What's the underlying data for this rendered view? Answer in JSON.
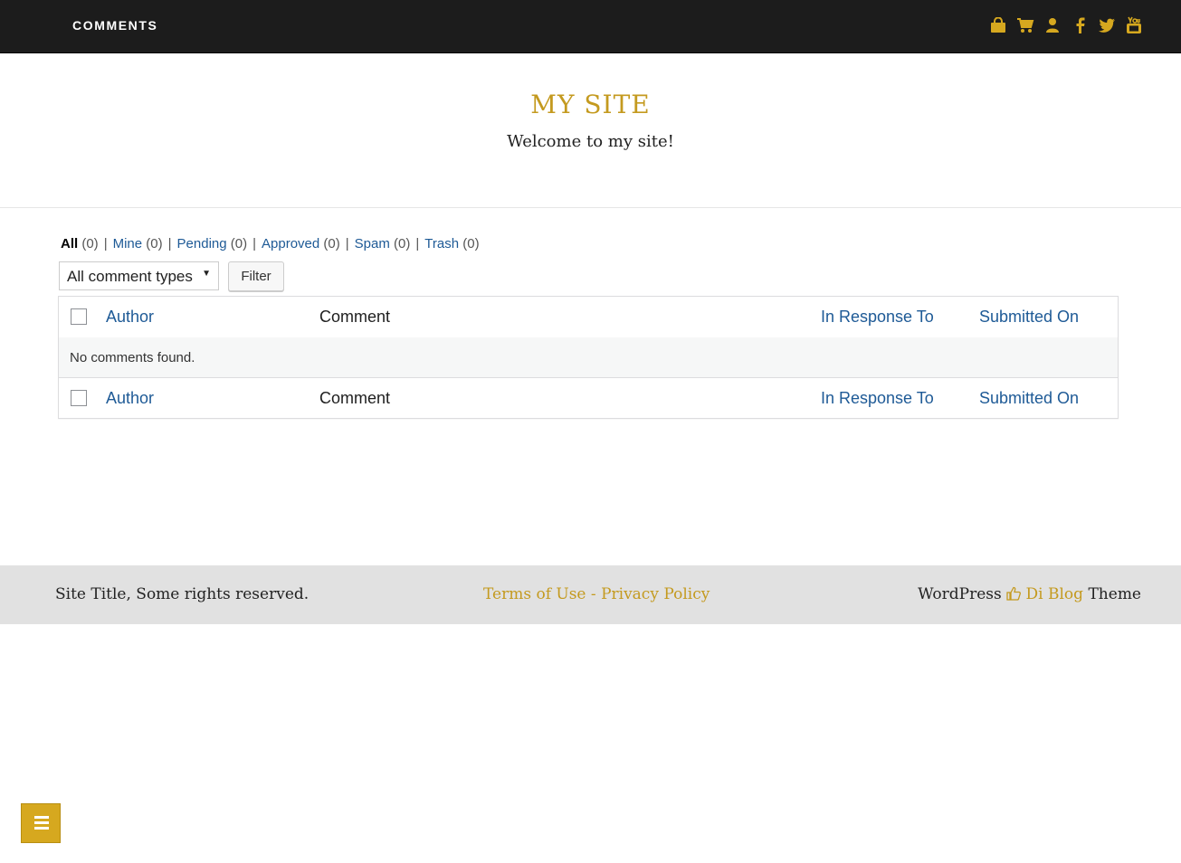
{
  "topbar": {
    "menu_title": "COMMENTS",
    "social_icons": [
      "shopping-bag-icon",
      "shopping-cart-icon",
      "user-icon",
      "facebook-icon",
      "twitter-icon",
      "youtube-icon"
    ],
    "icon_color": "#d6a81f"
  },
  "header": {
    "site_title": "MY SITE",
    "site_description": "Welcome to my site!"
  },
  "filters": {
    "items": [
      {
        "label": "All",
        "count": "(0)"
      },
      {
        "label": "Mine",
        "count": "(0)"
      },
      {
        "label": "Pending",
        "count": "(0)"
      },
      {
        "label": "Approved",
        "count": "(0)"
      },
      {
        "label": "Spam",
        "count": "(0)"
      },
      {
        "label": "Trash",
        "count": "(0)"
      }
    ],
    "separator": "|",
    "type_select": "All comment types",
    "filter_button": "Filter"
  },
  "table": {
    "columns": [
      "Author",
      "Comment",
      "In Response To",
      "Submitted On"
    ],
    "empty_message": "No comments found."
  },
  "footer": {
    "copyright": "Site Title, Some rights reserved.",
    "terms": "Terms of Use",
    "link_sep": " - ",
    "privacy": "Privacy Policy",
    "credit_prefix": "WordPress",
    "credit_theme": "Di Blog",
    "credit_suffix": "Theme"
  },
  "colors": {
    "accent": "#c49a1f",
    "link": "#1e5a96",
    "topbar_bg": "#1c1c1c",
    "footer_bg": "#e1e1e1"
  }
}
